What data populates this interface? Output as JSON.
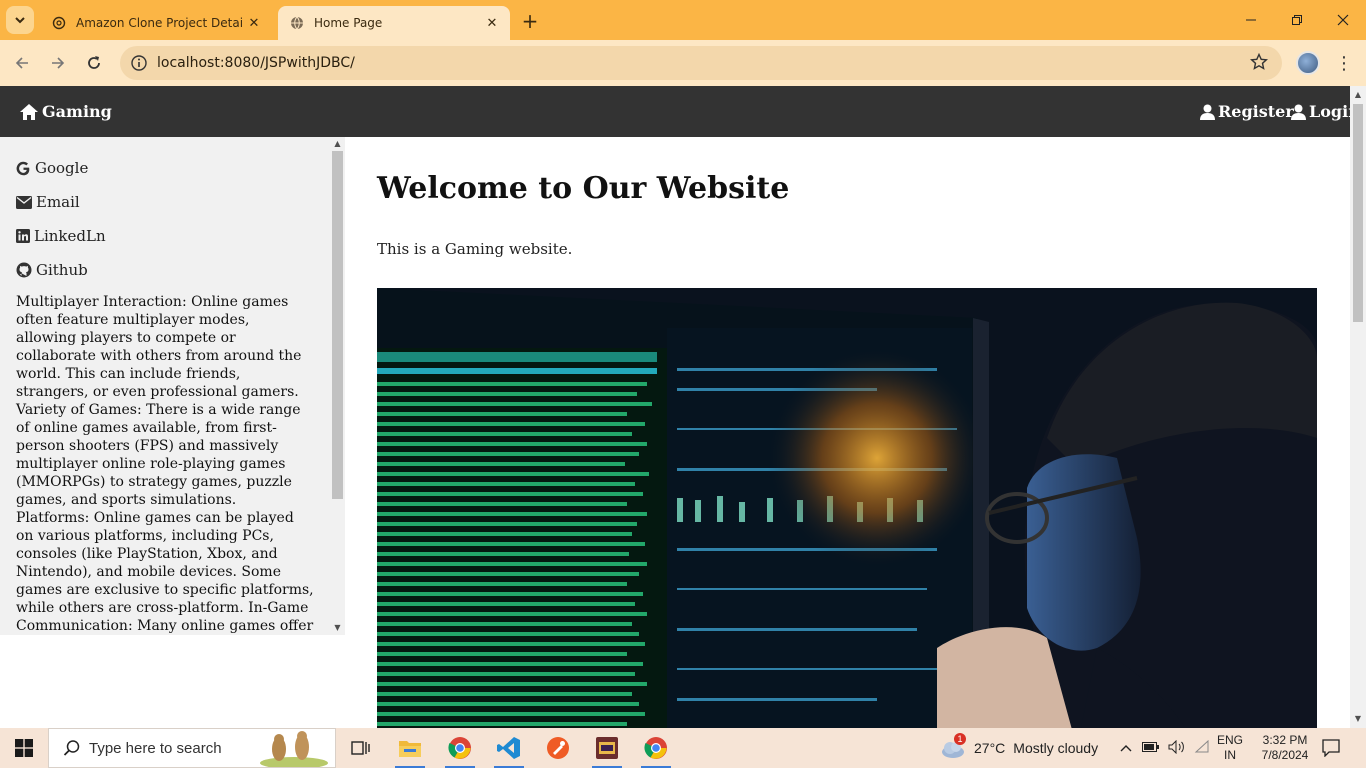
{
  "browser": {
    "tabs": [
      {
        "title": "Amazon Clone Project Details",
        "active": false
      },
      {
        "title": "Home Page",
        "active": true
      }
    ],
    "url": "localhost:8080/JSPwithJDBC/"
  },
  "navbar": {
    "brand": "Gaming",
    "links": [
      "Register",
      "Login"
    ]
  },
  "sidebar": {
    "links": [
      {
        "label": "Google",
        "icon": "google-icon"
      },
      {
        "label": "Email",
        "icon": "envelope-icon"
      },
      {
        "label": "LinkedLn",
        "icon": "linkedin-icon"
      },
      {
        "label": "Github",
        "icon": "github-icon"
      }
    ],
    "text": "Multiplayer Interaction: Online games often feature multiplayer modes, allowing players to compete or collaborate with others from around the world. This can include friends, strangers, or even professional gamers. Variety of Games: There is a wide range of online games available, from first-person shooters (FPS) and massively multiplayer online role-playing games (MMORPGs) to strategy games, puzzle games, and sports simulations. Platforms: Online games can be played on various platforms, including PCs, consoles (like PlayStation, Xbox, and Nintendo), and mobile devices. Some games are exclusive to specific platforms, while others are cross-platform. In-Game Communication: Many online games offer built-in communication tools such as voice chat, text chat, and messaging systems. This enhances the social aspect of gaming."
  },
  "main": {
    "heading": "Welcome to Our Website",
    "paragraph": "This is a Gaming website.",
    "image_icon": "hacker-monitor-photo"
  },
  "taskbar": {
    "search_placeholder": "Type here to search",
    "weather": {
      "temp": "27°C",
      "condition": "Mostly cloudy",
      "badge": "1"
    },
    "lang": "ENG",
    "region": "IN",
    "time": "3:32 PM",
    "date": "7/8/2024"
  },
  "colors": {
    "tabbar": "#fbb545",
    "toolbar": "#fde7c4",
    "navbar": "#333333",
    "sidebar": "#f1f1f1"
  }
}
